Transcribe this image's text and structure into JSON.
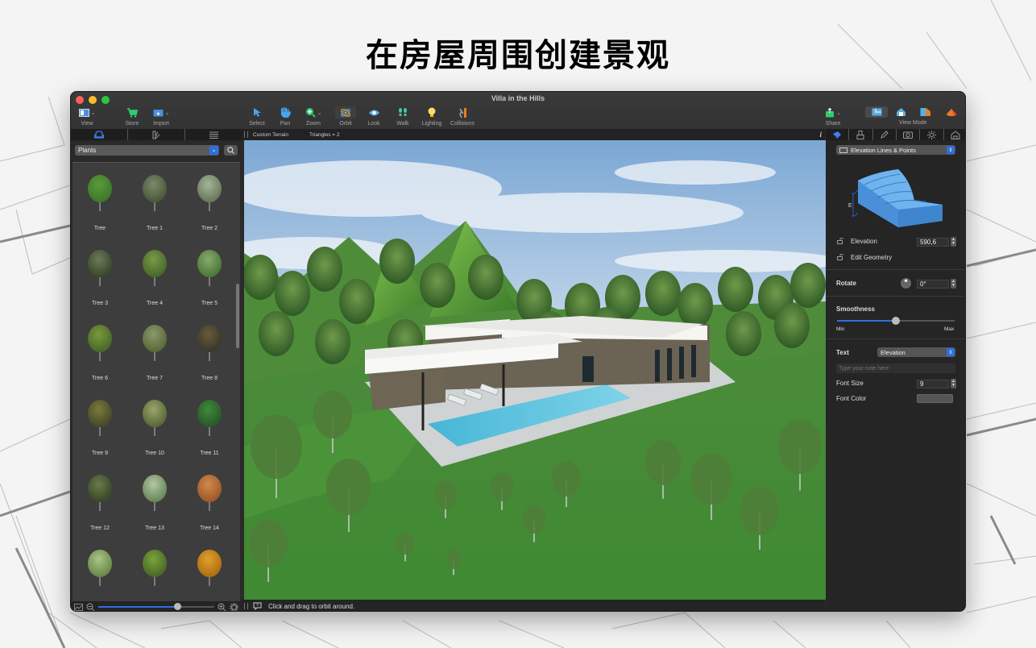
{
  "headline": "在房屋周围创建景观",
  "window": {
    "title": "Villa in the Hills"
  },
  "toolbar": {
    "left": [
      {
        "label": "View",
        "icon": "view-icon"
      },
      {
        "label": "Store",
        "icon": "cart-icon"
      },
      {
        "label": "Import",
        "icon": "import-icon"
      }
    ],
    "tools": [
      {
        "label": "Select",
        "icon": "cursor-icon"
      },
      {
        "label": "Pan",
        "icon": "hand-icon"
      },
      {
        "label": "Zoom",
        "icon": "zoom-icon"
      },
      {
        "label": "Orbit",
        "icon": "orbit-icon",
        "active": true
      },
      {
        "label": "Look",
        "icon": "eye-icon"
      },
      {
        "label": "Walk",
        "icon": "footprints-icon"
      },
      {
        "label": "Lighting",
        "icon": "bulb-icon"
      },
      {
        "label": "Collisions",
        "icon": "collision-icon"
      }
    ],
    "share_label": "Share",
    "view_mode_label": "View Mode"
  },
  "left_panel": {
    "tabs": [
      "furniture",
      "materials",
      "list"
    ],
    "category": "Plants",
    "items": [
      "Tree",
      "Tree 1",
      "Tree 2",
      "Tree 3",
      "Tree 4",
      "Tree 5",
      "Tree 6",
      "Tree 7",
      "Tree 8",
      "Tree 9",
      "Tree 10",
      "Tree 11",
      "Tree 12",
      "Tree 13",
      "Tree 14",
      "",
      "",
      ""
    ],
    "thumbnail_zoom": 0.68
  },
  "viewport": {
    "object_name": "Custom Terrain",
    "triangles": "Triangles = 2",
    "hint": "Click and drag to orbit around."
  },
  "inspector": {
    "mode": "Elevation Lines & Points",
    "diagram_label": "E",
    "elevation_label": "Elevation",
    "elevation_value": "590,6",
    "edit_geometry_label": "Edit Geometry",
    "rotate_label": "Rotate",
    "rotate_value": "0°",
    "smoothness_label": "Smoothness",
    "smoothness_min": "Min",
    "smoothness_max": "Max",
    "smoothness_value": 0.5,
    "text_label": "Text",
    "text_select": "Elevation",
    "note_placeholder": "Type your note here",
    "font_size_label": "Font Size",
    "font_size_value": "9",
    "font_color_label": "Font Color"
  }
}
